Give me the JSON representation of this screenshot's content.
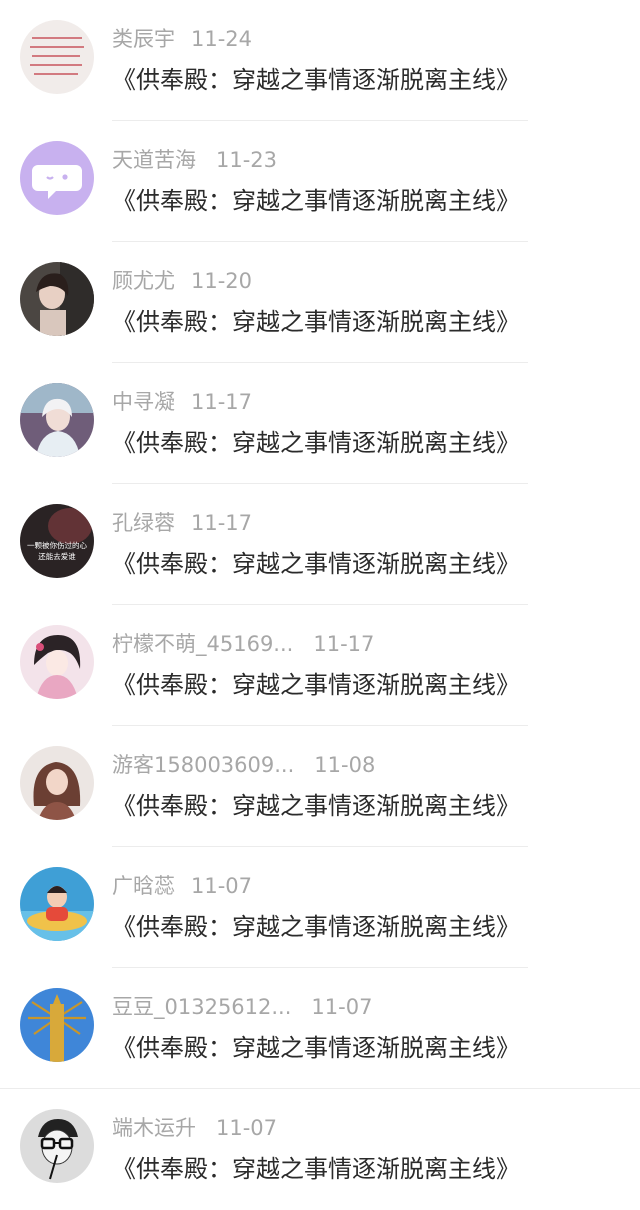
{
  "book_title": "《供奉殿：穿越之事情逐渐脱离主线》",
  "comments": [
    {
      "user": "类辰宇",
      "date": "11-24",
      "avatar": "handwritten-note-avatar"
    },
    {
      "user": "天道苦海",
      "date": "11-23",
      "avatar": "purple-chat-bubble-avatar"
    },
    {
      "user": "顾尤尤",
      "date": "11-20",
      "avatar": "girl-photo-avatar"
    },
    {
      "user": "中寻凝",
      "date": "11-17",
      "avatar": "girl-anime-avatar"
    },
    {
      "user": "孔绿蓉",
      "date": "11-17",
      "avatar": "dark-quote-avatar",
      "avatar_text": [
        "一颗被你伤过的心",
        "还能去爱谁"
      ]
    },
    {
      "user": "柠檬不萌_45169...",
      "date": "11-17",
      "avatar": "anime-girl-avatar"
    },
    {
      "user": "游客158003609...",
      "date": "11-08",
      "avatar": "woman-photo-avatar"
    },
    {
      "user": "广晗蕊",
      "date": "11-07",
      "avatar": "child-pool-avatar"
    },
    {
      "user": "豆豆_01325612...",
      "date": "11-07",
      "avatar": "golden-statue-avatar"
    },
    {
      "user": "端木运升",
      "date": "11-07",
      "avatar": "glasses-sketch-avatar"
    }
  ]
}
